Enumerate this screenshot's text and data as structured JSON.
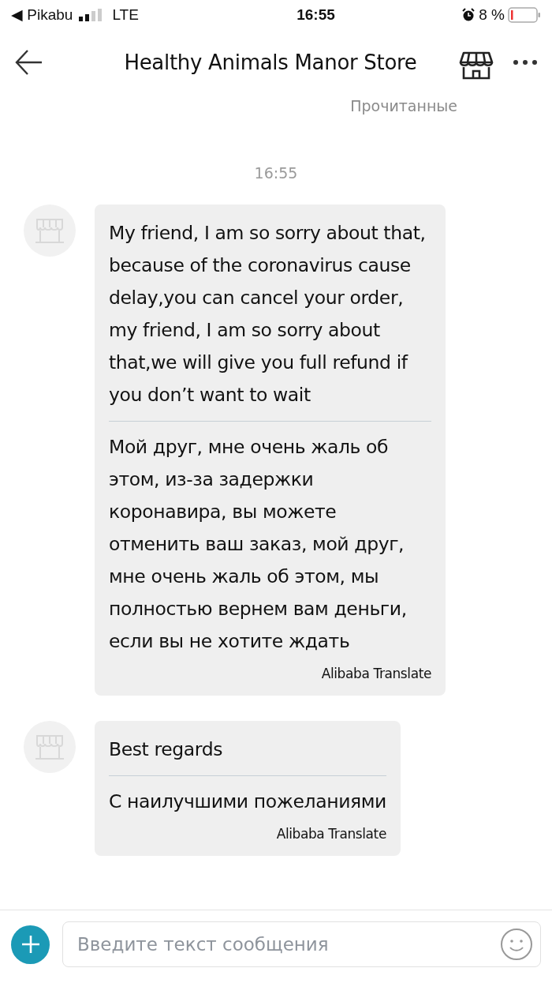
{
  "status_bar": {
    "back_app": "◀ Pikabu",
    "network": "LTE",
    "time": "16:55",
    "battery": "8 %"
  },
  "header": {
    "title": "Healthy Animals Manor Store",
    "read_status": "Прочитанные"
  },
  "timestamp": "16:55",
  "messages": [
    {
      "text": "My friend, I am so sorry about that, because of the coronavirus cause delay,you can cancel your order, my friend, I am so sorry about that,we will give you full refund if you don’t want to wait",
      "translation": "Мой друг, мне очень жаль об этом, из-за задержки коронавира, вы можете отменить ваш заказ, мой друг, мне очень жаль об этом, мы полностью вернем вам деньги, если вы не хотите ждать",
      "translator": "Alibaba Translate"
    },
    {
      "text": "Best regards",
      "translation": "С наилучшими пожеланиями",
      "translator": "Alibaba Translate"
    }
  ],
  "composer": {
    "placeholder": "Введите текст сообщения"
  }
}
